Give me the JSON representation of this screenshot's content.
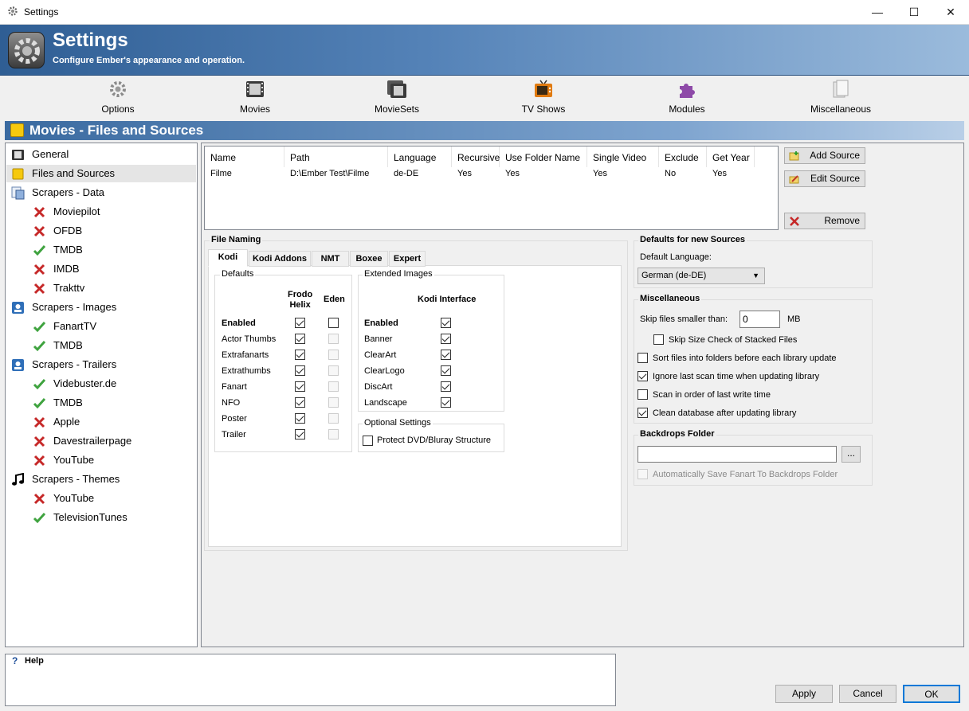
{
  "window": {
    "title": "Settings",
    "controls": [
      "—",
      "☐",
      "✕"
    ]
  },
  "header": {
    "title": "Settings",
    "subtitle": "Configure Ember's appearance and operation."
  },
  "toolbar": [
    {
      "label": "Options",
      "icon": "gear-icon"
    },
    {
      "label": "Movies",
      "icon": "film-icon"
    },
    {
      "label": "MovieSets",
      "icon": "film-stack-icon"
    },
    {
      "label": "TV Shows",
      "icon": "tv-icon"
    },
    {
      "label": "Modules",
      "icon": "puzzle-icon"
    },
    {
      "label": "Miscellaneous",
      "icon": "document-icon"
    }
  ],
  "section": {
    "title": "Movies - Files and Sources"
  },
  "tree": [
    {
      "label": "General",
      "icon": "film-icon",
      "level": 0
    },
    {
      "label": "Files and Sources",
      "icon": "folder-icon",
      "level": 0,
      "selected": true
    },
    {
      "label": "Scrapers - Data",
      "icon": "data-scraper-icon",
      "level": 0
    },
    {
      "label": "Moviepilot",
      "icon": "x-icon",
      "level": 1
    },
    {
      "label": "OFDB",
      "icon": "x-icon",
      "level": 1
    },
    {
      "label": "TMDB",
      "icon": "check-icon",
      "level": 1
    },
    {
      "label": "IMDB",
      "icon": "x-icon",
      "level": 1
    },
    {
      "label": "Trakttv",
      "icon": "x-icon",
      "level": 1
    },
    {
      "label": "Scrapers - Images",
      "icon": "image-scraper-icon",
      "level": 0
    },
    {
      "label": "FanartTV",
      "icon": "check-icon",
      "level": 1
    },
    {
      "label": "TMDB",
      "icon": "check-icon",
      "level": 1
    },
    {
      "label": "Scrapers - Trailers",
      "icon": "trailer-scraper-icon",
      "level": 0
    },
    {
      "label": "Videbuster.de",
      "icon": "check-icon",
      "level": 1
    },
    {
      "label": "TMDB",
      "icon": "check-icon",
      "level": 1
    },
    {
      "label": "Apple",
      "icon": "x-icon",
      "level": 1
    },
    {
      "label": "Davestrailerpage",
      "icon": "x-icon",
      "level": 1
    },
    {
      "label": "YouTube",
      "icon": "x-icon",
      "level": 1
    },
    {
      "label": "Scrapers - Themes",
      "icon": "music-note-icon",
      "level": 0
    },
    {
      "label": "YouTube",
      "icon": "x-icon",
      "level": 1
    },
    {
      "label": "TelevisionTunes",
      "icon": "check-icon",
      "level": 1
    }
  ],
  "sources": {
    "columns": [
      "Name",
      "Path",
      "Language",
      "Recursive",
      "Use Folder Name",
      "Single Video",
      "Exclude",
      "Get Year"
    ],
    "rows": [
      [
        "Filme",
        "D:\\Ember Test\\Filme",
        "de-DE",
        "Yes",
        "Yes",
        "Yes",
        "No",
        "Yes"
      ]
    ],
    "buttons": {
      "add": "Add Source",
      "edit": "Edit Source",
      "remove": "Remove"
    }
  },
  "file_naming": {
    "title": "File Naming",
    "tabs": [
      "Kodi",
      "Kodi Addons",
      "NMT",
      "Boxee",
      "Expert"
    ],
    "defaults": {
      "title": "Defaults",
      "col1": "Frodo\nHelix",
      "col2": "Eden",
      "rows": [
        {
          "label": "Enabled",
          "bold": true,
          "frodo": true,
          "eden": false,
          "eden_disabled": false
        },
        {
          "label": "Actor Thumbs",
          "frodo": true,
          "eden": false,
          "eden_disabled": true
        },
        {
          "label": "Extrafanarts",
          "frodo": true,
          "eden": false,
          "eden_disabled": true
        },
        {
          "label": "Extrathumbs",
          "frodo": true,
          "eden": false,
          "eden_disabled": true
        },
        {
          "label": "Fanart",
          "frodo": true,
          "eden": false,
          "eden_disabled": true
        },
        {
          "label": "NFO",
          "frodo": true,
          "eden": false,
          "eden_disabled": true
        },
        {
          "label": "Poster",
          "frodo": true,
          "eden": false,
          "eden_disabled": true
        },
        {
          "label": "Trailer",
          "frodo": true,
          "eden": false,
          "eden_disabled": true
        }
      ]
    },
    "extended": {
      "title": "Extended Images",
      "col": "Kodi Interface",
      "rows": [
        {
          "label": "Enabled",
          "bold": true,
          "checked": true
        },
        {
          "label": "Banner",
          "checked": true
        },
        {
          "label": "ClearArt",
          "checked": true
        },
        {
          "label": "ClearLogo",
          "checked": true
        },
        {
          "label": "DiscArt",
          "checked": true
        },
        {
          "label": "Landscape",
          "checked": true
        }
      ]
    },
    "optional": {
      "title": "Optional Settings",
      "label": "Protect DVD/Bluray Structure",
      "checked": false
    }
  },
  "defaults_new": {
    "title": "Defaults for new Sources",
    "language_label": "Default Language:",
    "language_value": "German (de-DE)"
  },
  "misc": {
    "title": "Miscellaneous",
    "skip_label": "Skip files smaller than:",
    "skip_value": "0",
    "skip_unit": "MB",
    "options": [
      {
        "label": "Skip Size Check of Stacked Files",
        "checked": false,
        "indent": true
      },
      {
        "label": "Sort files into folders before each library update",
        "checked": false
      },
      {
        "label": "Ignore last scan time when updating library",
        "checked": true
      },
      {
        "label": "Scan in order of last write time",
        "checked": false
      },
      {
        "label": "Clean database after updating library",
        "checked": true
      }
    ]
  },
  "backdrops": {
    "title": "Backdrops Folder",
    "path": "",
    "browse": "...",
    "auto_label": "Automatically Save Fanart To Backdrops Folder"
  },
  "help": {
    "title": "Help"
  },
  "dialog": {
    "apply": "Apply",
    "cancel": "Cancel",
    "ok": "OK"
  },
  "colors": {
    "accent": "#0078d7",
    "header": "#5583b8"
  }
}
